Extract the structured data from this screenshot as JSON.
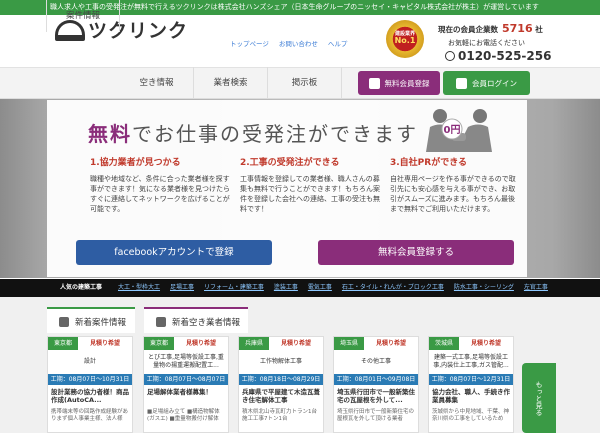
{
  "topbar": {
    "text": "職人求人や工事の受発注が無料で行えるツクリンクは株式会社ハンズシェア（日本生命グループのニッセイ・キャピタル株式会社が株主）が運営しています"
  },
  "header": {
    "logo": "ツクリンク",
    "links": [
      "トップページ",
      "お問い合わせ",
      "ヘルプ"
    ],
    "badge": {
      "top": "建設業界",
      "main": "No.1"
    },
    "members_label": "現在の会員企業数",
    "members_count": "5716",
    "members_unit": "社",
    "contact_label": "お気軽にお電話ください",
    "phone": "0120-525-256"
  },
  "nav": {
    "items": [
      "案件情報",
      "空き情報",
      "業者検索",
      "掲示板"
    ],
    "register": "無料会員登録",
    "login": "会員ログイン"
  },
  "hero": {
    "title_hl": "無料",
    "title_rest": "でお仕事の受発注ができます",
    "price": "0円",
    "columns": [
      {
        "heading": "1.協力業者が見つかる",
        "body": "職種や地域など、条件に合った業者様を探す事ができます！気になる業者様を見つけたらすぐに連絡してネットワークを広げることが可能です。"
      },
      {
        "heading": "2.工事の受発注ができる",
        "body": "工事情報を登録しての業者様、職人さんの募集も無料で行うことができます！もちろん案件を登録した会社への連絡、工事の受注も無料です！"
      },
      {
        "heading": "3.自社PRができる",
        "body": "自社専用ページを作る事ができるので取引先にも安心感を与える事ができ、お取引がスムーズに進みます。もちろん最後まで無料でご利用いただけます。"
      }
    ],
    "fb_button": "facebookアカウントで登録",
    "free_button": "無料会員登録する"
  },
  "catbar": {
    "label": "人気の建築工事",
    "items": [
      "大工・型枠大工",
      "足場工事",
      "リフォーム・建築工事",
      "塗装工事",
      "電気工事",
      "石工・タイル・れんが・ブロック工事",
      "防水工事・シーリング",
      "左官工事"
    ]
  },
  "tabs": [
    "新着案件情報",
    "新着空き業者情報"
  ],
  "cards": [
    {
      "area": "東京都",
      "est": "見積り希望",
      "category": "設計",
      "period": "工期：08月07日〜10月31日",
      "title": "設計業務の協力者様！商品作成(AutoCA...",
      "desc": "携帯端末等の回路作成経験がありまず個人事業主様、法人様"
    },
    {
      "area": "東京都",
      "est": "見積り希望",
      "category": "とび工事,足場等仮設工事,重量物の揚重運搬配置工...",
      "period": "工期：08月07日〜08月07日",
      "title": "足場解体業者様募集！",
      "desc": "■足場組み立て ■構造物解体(ガスエ) ■重量物搬付け解体"
    },
    {
      "area": "兵庫県",
      "est": "見積り希望",
      "category": "工作物解体工事",
      "period": "工期：08月18日〜08月29日",
      "title": "兵庫県で平屋建て木造瓦葺き住宅解体工事",
      "desc": "積木県北山寺瓦町力トラン1台施工工事7トン1台"
    },
    {
      "area": "埼玉県",
      "est": "見積り希望",
      "category": "その他工事",
      "period": "工期：08月01日〜09月08日",
      "title": "埼玉県行田市で一般新築住宅の瓦屋根を外して...",
      "desc": "埼玉県行田市で一般新築住宅の屋根瓦を外して頂ける業者"
    },
    {
      "area": "茨城県",
      "est": "見積り希望",
      "category": "建築一式工事,足場等仮設工事,内装仕上工事,ガス管配...",
      "period": "工期：08月07日〜12月31日",
      "title": "協力会社、職人、手続き作業員募集",
      "desc": "茨城県から中見地域、千葉、神奈川県の工事をしているため"
    }
  ],
  "more": "もっと見る"
}
